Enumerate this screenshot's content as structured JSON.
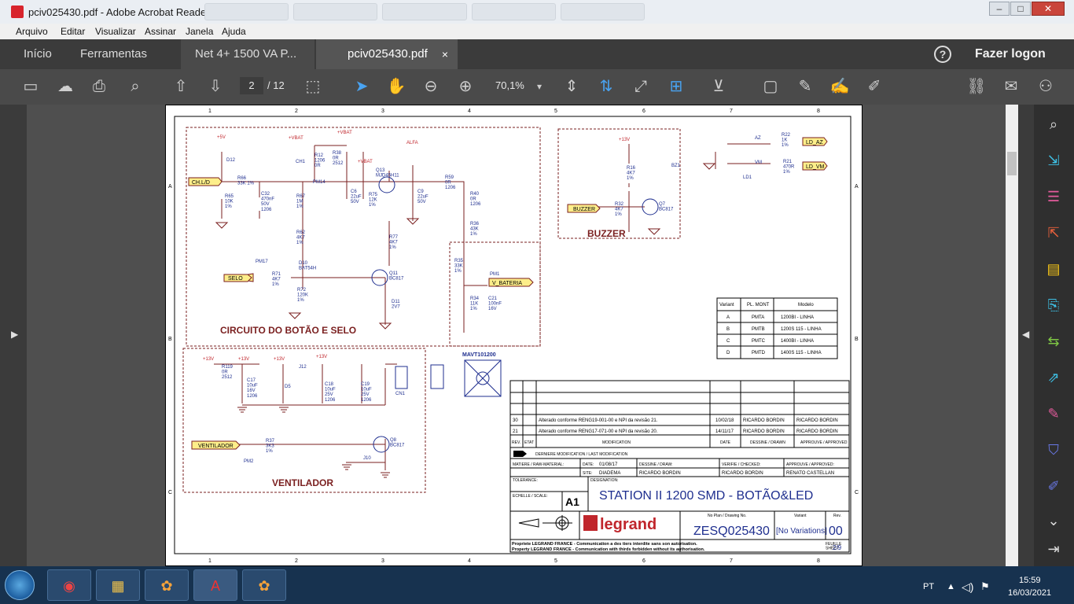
{
  "window": {
    "title": "pciv025430.pdf - Adobe Acrobat Reader DC (32-bit)"
  },
  "menu": [
    "Arquivo",
    "Editar",
    "Visualizar",
    "Assinar",
    "Janela",
    "Ajuda"
  ],
  "tabs": {
    "home": "Início",
    "tools": "Ferramentas",
    "doc1": "Net 4+ 1500 VA P...",
    "doc2": "pciv025430.pdf",
    "close": "×"
  },
  "account": {
    "logon": "Fazer logon",
    "help": "?"
  },
  "toolbar": {
    "page_current": "2",
    "page_total": "/ 12",
    "zoom": "70,1%"
  },
  "schematic": {
    "col_numbers": [
      "1",
      "2",
      "3",
      "4",
      "5",
      "6",
      "7",
      "8"
    ],
    "row_letters": [
      "A",
      "B",
      "C"
    ],
    "blocks": {
      "botao_selo": "CIRCUITO DO BOTÃO E SELO",
      "buzzer": "BUZZER",
      "ventilador": "VENTILADOR"
    },
    "nets": {
      "chld": "CH.L/D",
      "selo": "SELO",
      "vbateria": "V_BATERIA",
      "buzzer": "BUZZER",
      "ventilador": "VENTILADOR",
      "ldaz": "LD_AZ",
      "ldvm": "LD_VM"
    },
    "rails": {
      "v5": "+5V",
      "vbat": "+VBAT",
      "alfa": "ALFA",
      "v13": "+13V"
    },
    "parts": {
      "q13": "Q13\nMJD45H11",
      "q11": "Q11\nBC817",
      "q7": "Q7\nBC817",
      "q8": "Q8\nBC817",
      "d10": "D10\nBAT54H",
      "d12": "D12",
      "d11": "D11\n2V7",
      "d5": "D5",
      "r66": "R66\n33K 1%",
      "r65": "R65\n10K\n1%",
      "r67": "R67\n1M\n1%",
      "r62": "R62\n4K7\n1%",
      "r71": "R71\n4K7\n1%",
      "r72": "R72\n120K\n1%",
      "r59": "R59\n0R\n1206",
      "r40": "R40\n0R\n1206",
      "r36": "R36\n43K\n1%",
      "r35": "R35\n33K\n1%",
      "r34": "R34\n11K\n1%",
      "c21": "C21\n100nF\n16V",
      "c32": "C32\n470nF\n50V\n1206",
      "c6": "C6\n22uF\n50V",
      "c9": "C9\n22uF\n50V",
      "r75": "R75\n12K\n1%",
      "r77": "R77\n4K7\n1%",
      "r12": "R12\n1206\n0R",
      "r38": "R38\n0R\n2512",
      "r16": "R16\n4K7\n1%",
      "r32": "R32\n4K7\n1%",
      "bz1": "BZ1",
      "r22": "R22\n1K\n1%",
      "r21": "R21\n470R\n1%",
      "az": "AZ",
      "vm": "VM",
      "ld1": "LD1",
      "r119": "R119\n0R\n2512",
      "c17": "C17\n10uF\n16V\n1206",
      "c18": "C18\n10uF\n25V\n1206",
      "c19": "C19\n10uF\n25V\n1206",
      "j12": "J12",
      "j10": "J10",
      "r37": "R37\n3K3\n1%",
      "cn1": "CN1",
      "pm1": "PM1",
      "pm2": "PM2",
      "pm14": "PM14",
      "pm17": "PM17",
      "ch1": "CH1",
      "mavt": "MAVT101200"
    },
    "variant_table": {
      "headers": [
        "Variant",
        "PL. MONT",
        "Modelo"
      ],
      "rows": [
        [
          "A",
          "PMTA",
          "1200BI - LINHA"
        ],
        [
          "B",
          "PMTB",
          "1200S 115 - LINHA"
        ],
        [
          "C",
          "PMTC",
          "1400BI - LINHA"
        ],
        [
          "D",
          "PMTD",
          "1400S 115 - LINHA"
        ]
      ]
    },
    "revisions": [
      {
        "rev": "30",
        "mod": "Alterado conforme RENG19-001-00 e NPI da revisão 21.",
        "date": "10/02/18",
        "drawn": "RICARDO BORDIN",
        "approved": "RICARDO BORDIN"
      },
      {
        "rev": "21",
        "mod": "Alterado conforme RENG17-071-00 e NPI da revisão 20.",
        "date": "14/11/17",
        "drawn": "RICARDO BORDIN",
        "approved": "RICARDO BORDIN"
      }
    ],
    "title_block": {
      "rev_hdr": "REV.",
      "etat_hdr": "ETAT",
      "mod_hdr": "MODIFICATION",
      "date_hdr": "DATE",
      "drawn_hdr": "DESSINE / DRAWN",
      "appr_hdr": "APPROUVE / APPROVED",
      "last_mod": "DERNIERE MODIFICATION / LAST MODIFICATION",
      "matiere": "MATIERE / RAW-MATERIAL:",
      "date_lbl": "DATE:",
      "date_val": "01/08/17",
      "site_lbl": "SITE:",
      "site_val": "DIADEMA",
      "dessine_lbl": "DESSINE / DRAW:",
      "dessine_val": "RICARDO BORDIN",
      "verifie_lbl": "VERIFIE / CHECKED:",
      "verifie_val": "RICARDO BORDIN",
      "approuve_lbl": "APPROUVE / APPROVED:",
      "approuve_val": "RENATO CASTELLAN",
      "tolerance": "TOLERANCE:",
      "designation_lbl": "DESIGNATION:",
      "designation": "STATION II 1200 SMD - BOTÃO&LED",
      "echelle": "ECHELLE / SCALE:",
      "format": "A1",
      "brand": "legrand",
      "plan_lbl": "No Plan / Drawing No.",
      "plan_no": "ZESQ025430",
      "variant_lbl": "Variant",
      "variant_val": "[No Variations]",
      "rev_lbl": "Rev.",
      "rev_val": "00",
      "prop_fr": "Propriete LEGRAND FRANCE - Communication a des tiers interdite sans son autorisation.",
      "prop_en": "Property LEGRAND FRANCE - Communication with thirds forbidden without its authorisation.",
      "sheet_lbl": "FEUILLE\nSHEET:",
      "sheet_val": "2/9"
    }
  },
  "taskbar": {
    "lang": "PT",
    "time": "15:59",
    "date": "16/03/2021"
  }
}
